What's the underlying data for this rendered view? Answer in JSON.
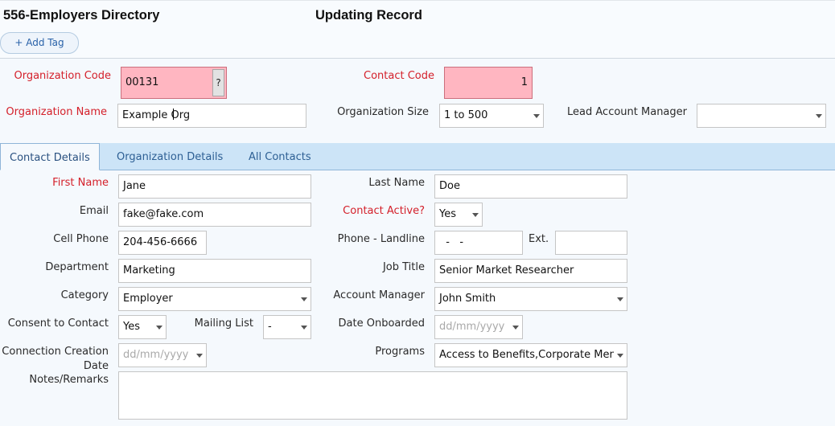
{
  "header": {
    "app_title": "556-Employers Directory",
    "mode_title": "Updating Record",
    "add_tag_label": "+ Add Tag"
  },
  "org": {
    "code_label": "Organization Code",
    "code_value": "00131",
    "lookup_label": "?",
    "contact_code_label": "Contact Code",
    "contact_code_value": "1",
    "name_label": "Organization Name",
    "name_value": "Example Org",
    "size_label": "Organization Size",
    "size_value": "1 to 500",
    "lead_manager_label": "Lead Account Manager",
    "lead_manager_value": ""
  },
  "tabs": [
    {
      "label": "Contact Details",
      "active": true
    },
    {
      "label": "Organization Details",
      "active": false
    },
    {
      "label": "All Contacts",
      "active": false
    }
  ],
  "contact": {
    "first_name_label": "First Name",
    "first_name_value": "Jane",
    "last_name_label": "Last Name",
    "last_name_value": "Doe",
    "email_label": "Email",
    "email_value": "fake@fake.com",
    "active_label": "Contact Active?",
    "active_value": "Yes",
    "cell_label": "Cell Phone",
    "cell_value": "204-456-6666",
    "landline_label": "Phone - Landline",
    "landline_value": "  -   -",
    "ext_label": "Ext.",
    "ext_value": "",
    "department_label": "Department",
    "department_value": "Marketing",
    "job_title_label": "Job Title",
    "job_title_value": "Senior Market Researcher",
    "category_label": "Category",
    "category_value": "Employer",
    "account_manager_label": "Account Manager",
    "account_manager_value": "John Smith",
    "consent_label": "Consent to Contact",
    "consent_value": "Yes",
    "mailing_label": "Mailing List",
    "mailing_value": "-",
    "onboarded_label": "Date Onboarded",
    "onboarded_placeholder": "dd/mm/yyyy",
    "connection_label_line1": "Connection Creation",
    "connection_label_line2": "Date",
    "connection_placeholder": "dd/mm/yyyy",
    "programs_label": "Programs",
    "programs_value": "Access to Benefits,Corporate Men",
    "notes_label": "Notes/Remarks",
    "notes_value": ""
  },
  "colors": {
    "required_label": "#d4202a",
    "required_field_bg": "#ffb6c1",
    "tab_bar": "#cce4f7",
    "tab_text": "#2d5f94"
  }
}
